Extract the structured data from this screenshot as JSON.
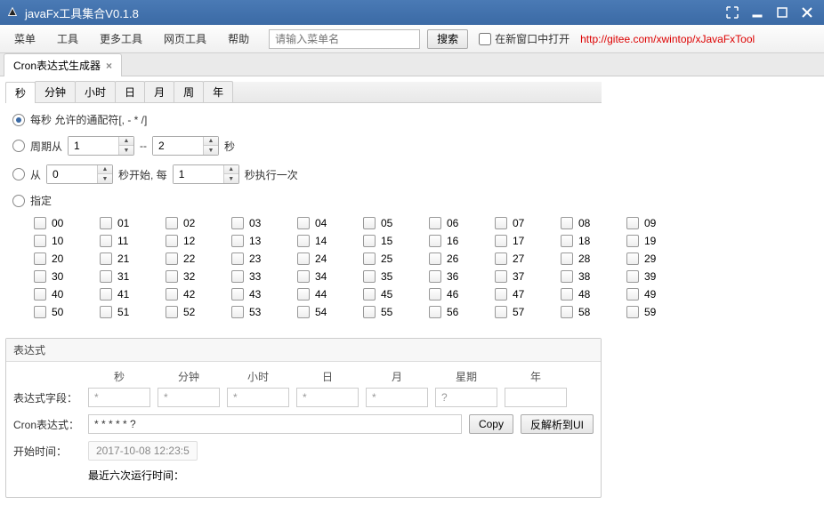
{
  "window": {
    "title": "javaFx工具集合V0.1.8"
  },
  "menu": {
    "items": [
      "菜单",
      "工具",
      "更多工具",
      "网页工具",
      "帮助"
    ],
    "search_placeholder": "请输入菜单名",
    "search_btn": "搜索",
    "open_new_window": "在新窗口中打开",
    "link_text": "http://gitee.com/xwintop/xJavaFxTool"
  },
  "tab": {
    "label": "Cron表达式生成器"
  },
  "subtabs": [
    "秒",
    "分钟",
    "小时",
    "日",
    "月",
    "周",
    "年"
  ],
  "options": {
    "opt1": "每秒 允许的通配符[, - * /]",
    "opt2_prefix": "周期从",
    "opt2_val1": "1",
    "opt2_mid": "--",
    "opt2_val2": "2",
    "opt2_suffix": "秒",
    "opt3_prefix": "从",
    "opt3_val1": "0",
    "opt3_mid": "秒开始,  每",
    "opt3_val2": "1",
    "opt3_suffix": "秒执行一次",
    "opt4": "指定"
  },
  "checkgrid": [
    [
      "00",
      "01",
      "02",
      "03",
      "04",
      "05",
      "06",
      "07",
      "08",
      "09"
    ],
    [
      "10",
      "11",
      "12",
      "13",
      "14",
      "15",
      "16",
      "17",
      "18",
      "19"
    ],
    [
      "20",
      "21",
      "22",
      "23",
      "24",
      "25",
      "26",
      "27",
      "28",
      "29"
    ],
    [
      "30",
      "31",
      "32",
      "33",
      "34",
      "35",
      "36",
      "37",
      "38",
      "39"
    ],
    [
      "40",
      "41",
      "42",
      "43",
      "44",
      "45",
      "46",
      "47",
      "48",
      "49"
    ],
    [
      "50",
      "51",
      "52",
      "53",
      "54",
      "55",
      "56",
      "57",
      "58",
      "59"
    ]
  ],
  "expr": {
    "group_title": "表达式",
    "headers": [
      "秒",
      "分钟",
      "小时",
      "日",
      "月",
      "星期",
      "年"
    ],
    "fields_label": "表达式字段：",
    "fields": [
      "*",
      "*",
      "*",
      "*",
      "*",
      "?",
      ""
    ],
    "cron_label": "Cron表达式：",
    "cron_value": "* * * * * ?",
    "copy_btn": "Copy",
    "parse_btn": "反解析到UI",
    "start_label": "开始时间：",
    "start_value": "2017-10-08 12:23:5",
    "recent_label": "最近六次运行时间："
  }
}
